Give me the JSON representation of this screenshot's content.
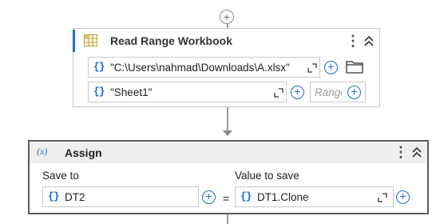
{
  "read_range": {
    "title": "Read Range Workbook",
    "workbook_path": "\"C:\\Users\\nahmad\\Downloads\\A.xlsx\"",
    "sheet_name": "\"Sheet1\"",
    "range_placeholder": "Range"
  },
  "assign": {
    "title": "Assign",
    "save_to_label": "Save to",
    "value_label": "Value to save",
    "save_to_value": "DT2",
    "value_to_save": "DT1.Clone",
    "equals": "="
  },
  "glyphs": {
    "curly": "{}",
    "plus": "+",
    "kebab": "⋮",
    "x_icon": "(x)"
  },
  "colors": {
    "accent": "#1f6fd1",
    "excel_green": "#2e7d32"
  }
}
